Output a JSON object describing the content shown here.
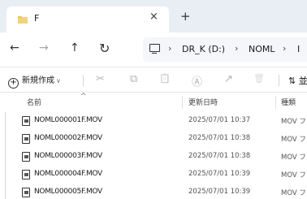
{
  "tab": {
    "title": "F",
    "close": "×",
    "new_tab": "+"
  },
  "nav": {
    "back": "←",
    "forward": "→",
    "up": "↑",
    "refresh": "↻"
  },
  "address": {
    "separator": "›",
    "crumbs": [
      "DR_K (D:)",
      "NOML",
      "I"
    ]
  },
  "commands": {
    "new_label": "新規作成",
    "new_plus": "+",
    "new_chevron": "∨",
    "sort_label": "⇅ 並"
  },
  "icons": {
    "cut": "✂",
    "copy": "⧉",
    "paste": "📋",
    "rename": "Ⓐ",
    "share": "↗",
    "delete": "🗑"
  },
  "columns": {
    "name": "名前",
    "modified": "更新日時",
    "type": "種類",
    "sort_indicator": "^"
  },
  "files": [
    {
      "name": "NOML000001F.MOV",
      "modified": "2025/07/01 10:37",
      "type": "MOV フ"
    },
    {
      "name": "NOML000002F.MOV",
      "modified": "2025/07/01 10:38",
      "type": "MOV フ"
    },
    {
      "name": "NOML000003F.MOV",
      "modified": "2025/07/01 10:38",
      "type": "MOV フ"
    },
    {
      "name": "NOML000004F.MOV",
      "modified": "2025/07/01 10:39",
      "type": "MOV フ"
    },
    {
      "name": "NOML000005F.MOV",
      "modified": "2025/07/01 10:39",
      "type": "MOV フ"
    }
  ],
  "colors": {
    "titlebar": "#e9eef5",
    "folder": "#e8c461"
  }
}
